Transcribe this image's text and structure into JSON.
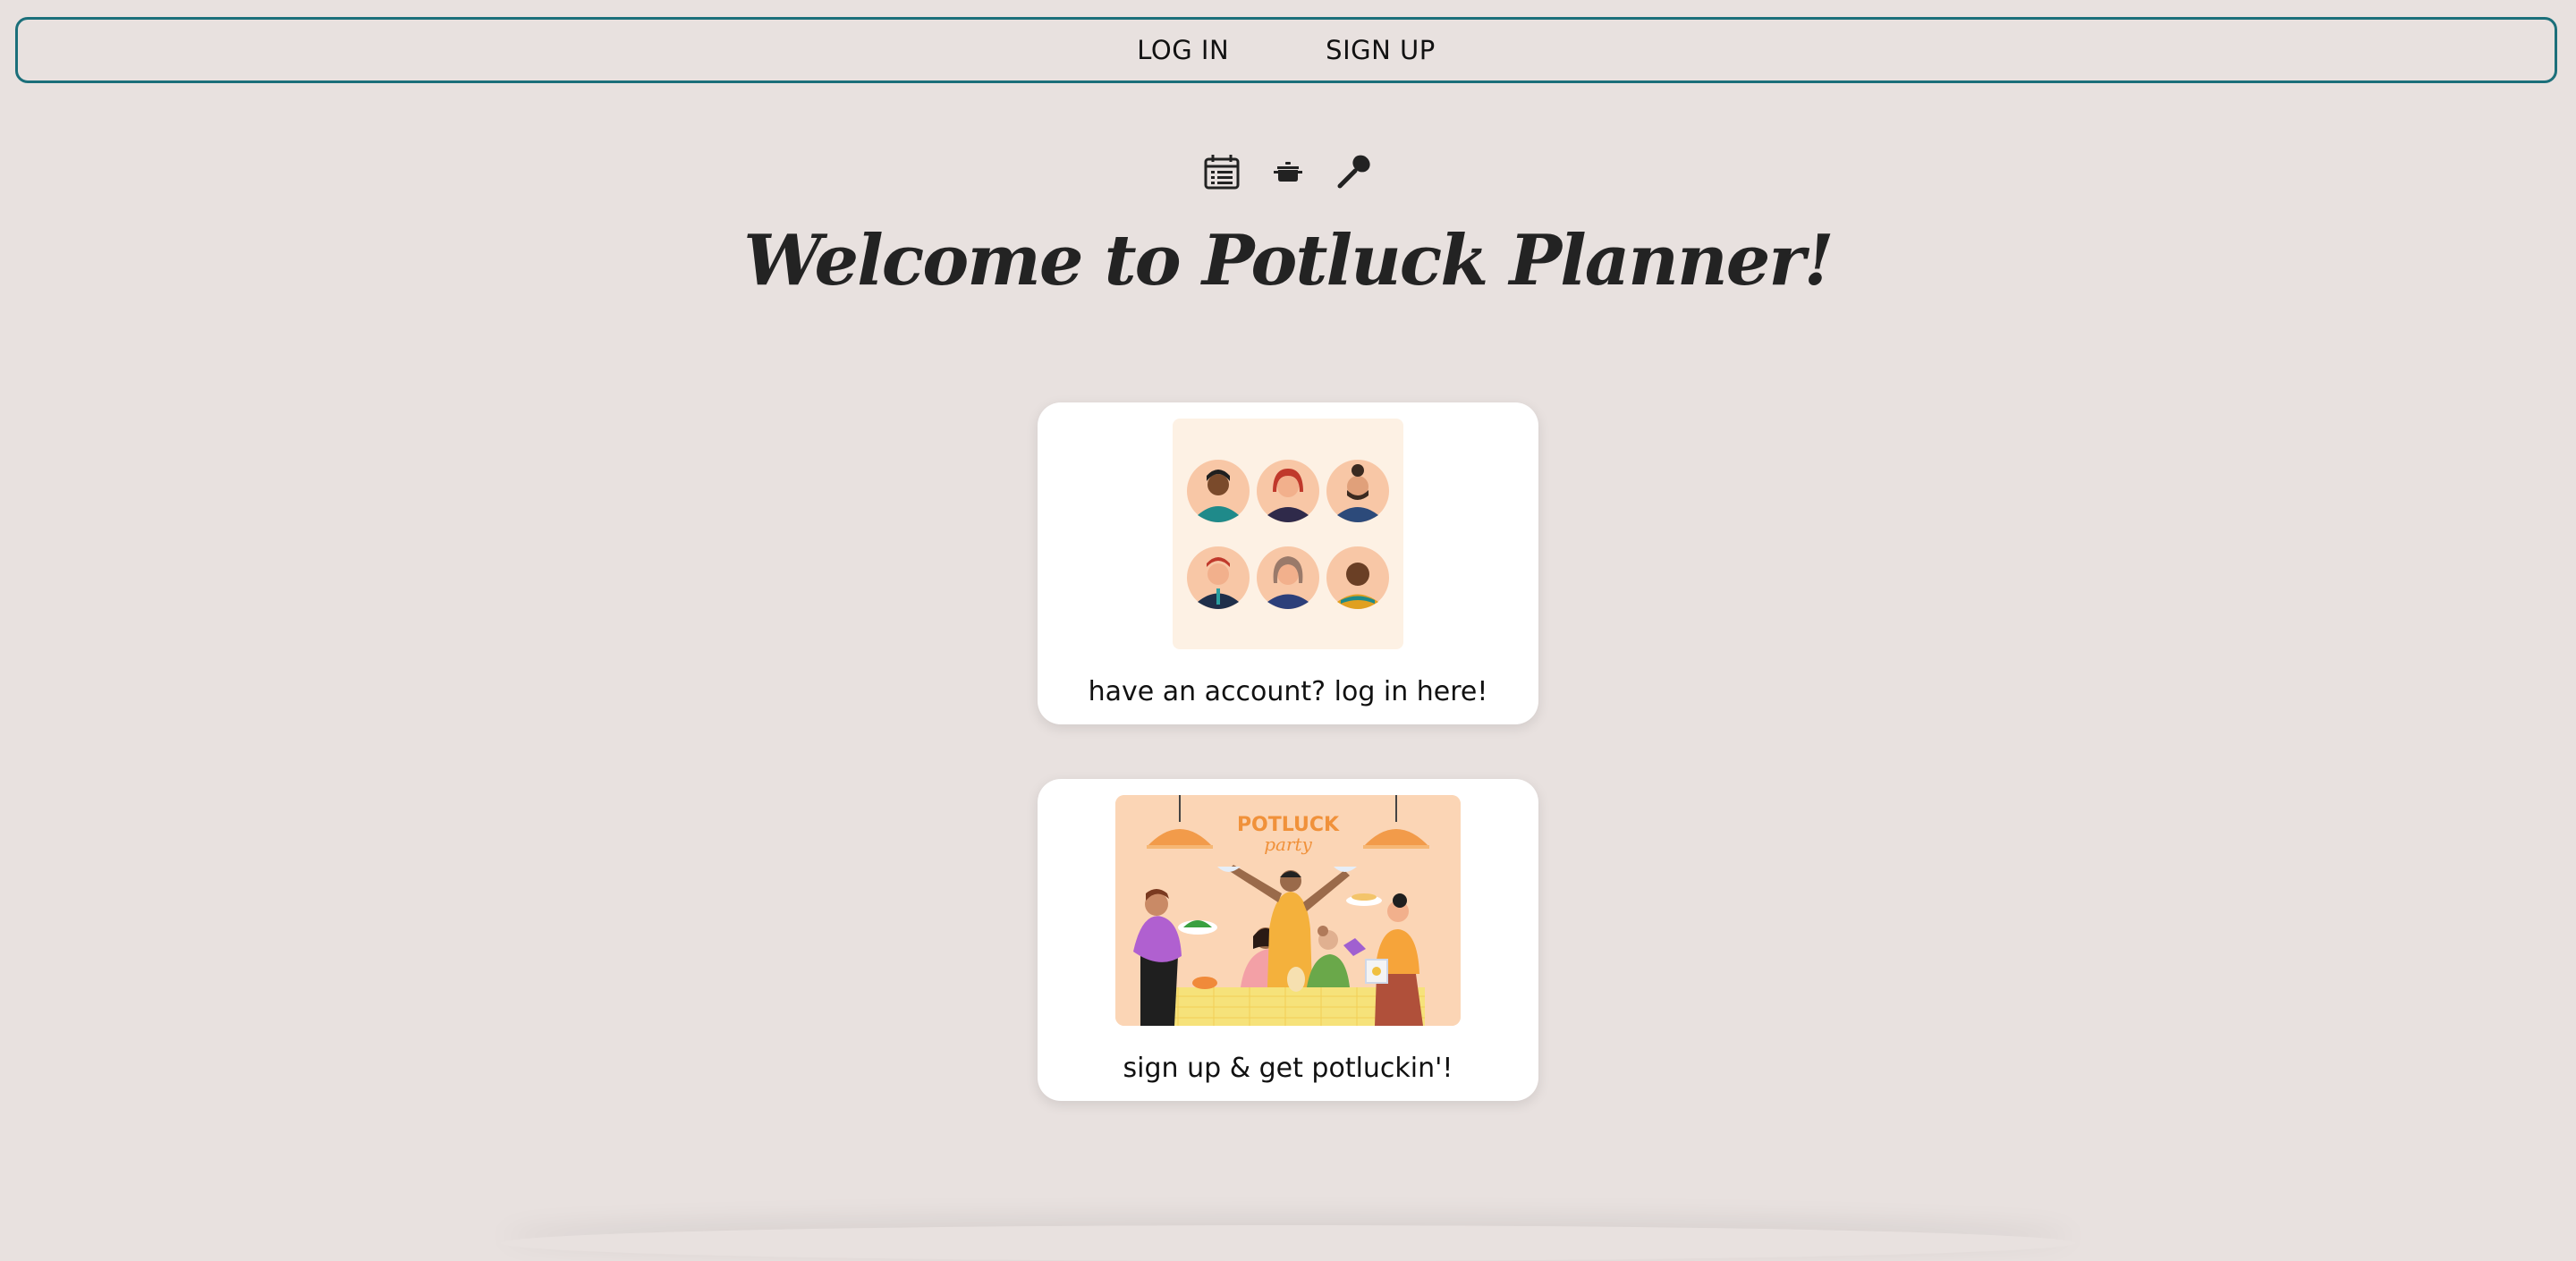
{
  "nav": {
    "login_label": "LOG IN",
    "signup_label": "SIGN UP"
  },
  "icons": [
    "calendar-icon",
    "pot-icon",
    "spoon-icon"
  ],
  "hero": {
    "title": "Welcome to Potluck Planner!"
  },
  "cards": {
    "login": {
      "caption": "have an account? log in here!",
      "image": "avatars-illustration"
    },
    "signup": {
      "caption": "sign up & get potluckin'!",
      "image": "potluck-party-illustration",
      "image_text_1": "POTLUCK",
      "image_text_2": "party"
    }
  },
  "colors": {
    "background": "#e8e1df",
    "nav_border": "#1b6f7a",
    "card": "#ffffff",
    "title": "#232323"
  }
}
